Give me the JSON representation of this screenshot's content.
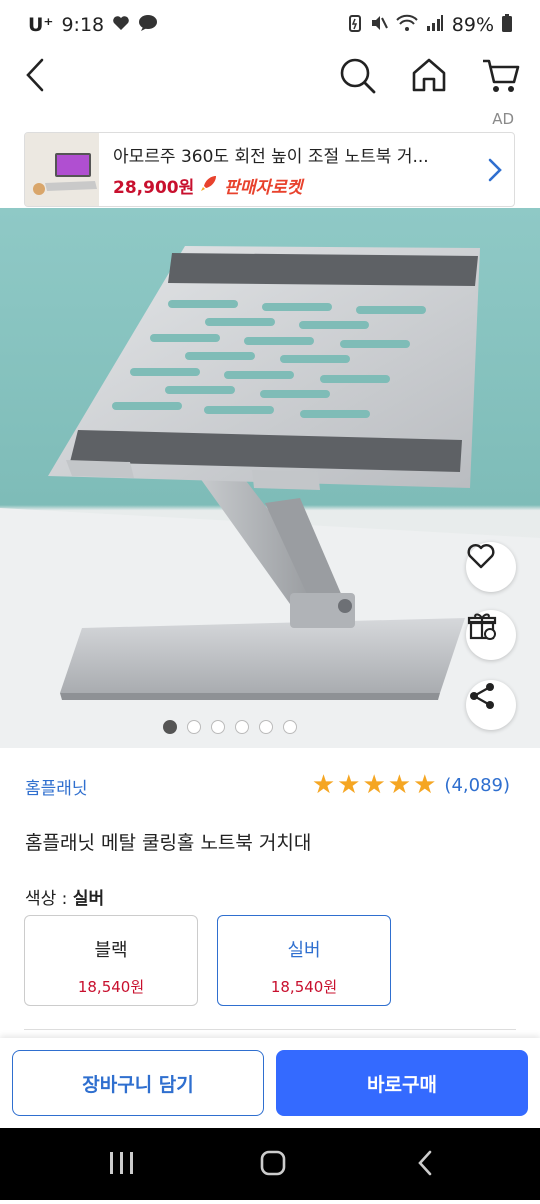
{
  "status": {
    "carrier": "U⁺",
    "time": "9:18",
    "battery": "89%"
  },
  "nav": {
    "back_icon": "chevron-left-icon",
    "search_icon": "search-icon",
    "home_icon": "home-icon",
    "cart_icon": "cart-icon"
  },
  "ad": {
    "tag": "AD",
    "title": "아모르주 360도 회전 높이 조절 노트북 거...",
    "price": "28,900원",
    "badge": "판매자로켓"
  },
  "carousel": {
    "total": 6,
    "active_index": 0
  },
  "product": {
    "brand": "홈플래닛",
    "rating_stars": 5,
    "review_count": "(4,089)",
    "title": "홈플래닛 메탈 쿨링홀 노트북 거치대"
  },
  "options": {
    "label_prefix": "색상 : ",
    "selected_value": "실버",
    "items": [
      {
        "name": "블랙",
        "price": "18,540원",
        "selected": false
      },
      {
        "name": "실버",
        "price": "18,540원",
        "selected": true
      }
    ]
  },
  "actions": {
    "cart_label": "장바구니 담기",
    "buy_label": "바로구매"
  },
  "colors": {
    "accent": "#346aff",
    "link": "#2f6fcf",
    "price": "#c8102e",
    "star": "#f5a623"
  }
}
